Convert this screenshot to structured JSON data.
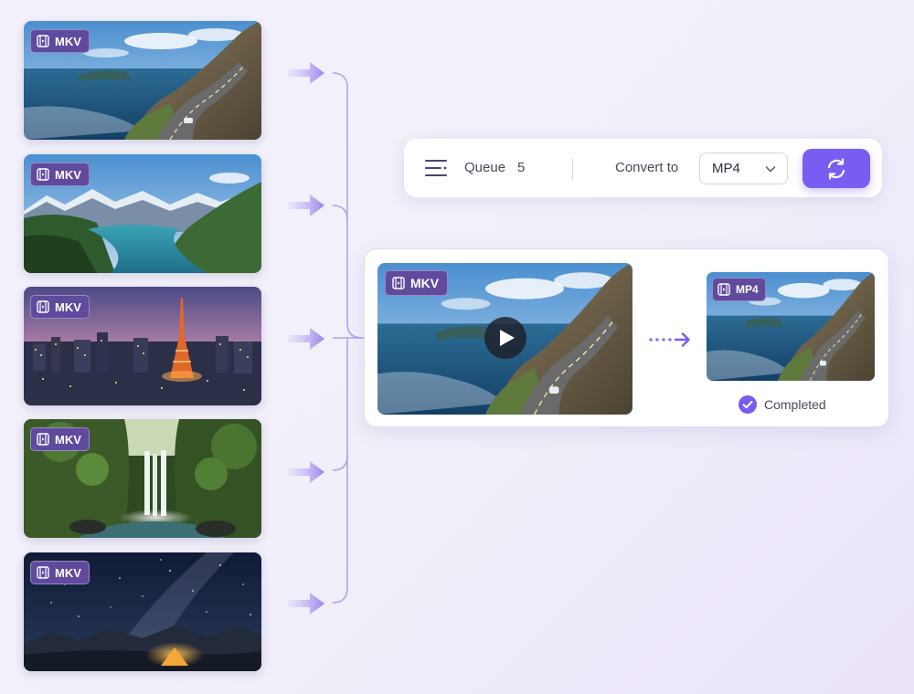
{
  "files": [
    {
      "format": "MKV",
      "scene": "coastal-road"
    },
    {
      "format": "MKV",
      "scene": "mountain-lake"
    },
    {
      "format": "MKV",
      "scene": "city-tower-dusk"
    },
    {
      "format": "MKV",
      "scene": "forest-waterfall"
    },
    {
      "format": "MKV",
      "scene": "night-sky-camping"
    }
  ],
  "toolbar": {
    "queue_label": "Queue",
    "queue_count": "5",
    "convert_label": "Convert to",
    "format_selected": "MP4",
    "convert_icon": "refresh-icon"
  },
  "conversion": {
    "source_format": "MKV",
    "target_format": "MP4",
    "status": "Completed"
  },
  "colors": {
    "accent": "#7b5cf0",
    "badge": "#5f4a9e",
    "connector": "#b4a3ea",
    "background": "#f2f0f9"
  }
}
